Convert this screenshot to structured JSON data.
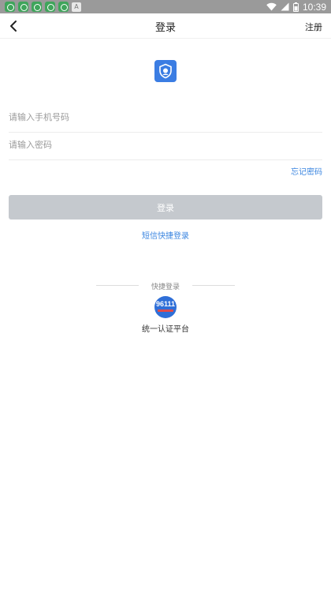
{
  "status_bar": {
    "time": "10:39",
    "notification_icons": [
      "app-icon",
      "app-icon",
      "app-icon",
      "app-icon",
      "app-icon",
      "text-icon"
    ],
    "text_icon_glyph": "A",
    "indicator_icons": [
      "wifi-icon",
      "signal-icon",
      "battery-icon"
    ],
    "background_color": "#9a9a9a"
  },
  "nav": {
    "back_icon": "chevron-left-icon",
    "title": "登录",
    "register_label": "注册"
  },
  "logo": {
    "icon": "shield-icon",
    "color": "#3b7de3"
  },
  "form": {
    "phone_placeholder": "请输入手机号码",
    "password_placeholder": "请输入密码",
    "forgot_password_label": "忘记密码",
    "login_button_label": "登录",
    "sms_login_label": "短信快捷登录"
  },
  "quick_login": {
    "title": "快捷登录",
    "items": [
      {
        "icon_text": "96111",
        "label": "统一认证平台",
        "color": "#2f6fd8"
      }
    ]
  },
  "colors": {
    "accent": "#3b86e0",
    "disabled_button": "#c5c9ce"
  }
}
